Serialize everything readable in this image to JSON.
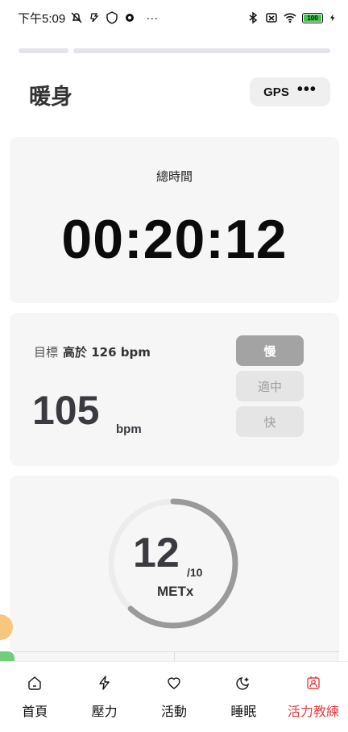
{
  "status_bar": {
    "time": "下午5:09",
    "more": "···",
    "battery_level": "100"
  },
  "header": {
    "title": "暖身",
    "gps_label": "GPS",
    "more_label": "•••"
  },
  "progress_segments": [
    {
      "filled": true
    },
    {
      "filled": false
    }
  ],
  "time_card": {
    "label": "總時間",
    "value": "00:20:12"
  },
  "heart_rate_card": {
    "target_prefix": "目標",
    "target_value": "高於 126 bpm",
    "value": "105",
    "unit": "bpm",
    "speed_options": [
      {
        "label": "慢",
        "active": true
      },
      {
        "label": "適中",
        "active": false
      },
      {
        "label": "快",
        "active": false
      }
    ]
  },
  "met_card": {
    "value": "12",
    "denominator": "/10",
    "unit": "METx",
    "progress_fraction": 0.62
  },
  "bottom_nav": {
    "items": [
      {
        "label": "首頁",
        "icon": "home-icon",
        "active": false
      },
      {
        "label": "壓力",
        "icon": "lightning-icon",
        "active": false
      },
      {
        "label": "活動",
        "icon": "heart-icon",
        "active": false
      },
      {
        "label": "睡眠",
        "icon": "moon-icon",
        "active": false
      },
      {
        "label": "活力教練",
        "icon": "coach-icon",
        "active": true
      }
    ]
  },
  "colors": {
    "accent_active": "#e34141",
    "card_bg": "#f6f6f6",
    "ring_progress": "#9a9a9a",
    "ring_track": "#ececec"
  }
}
